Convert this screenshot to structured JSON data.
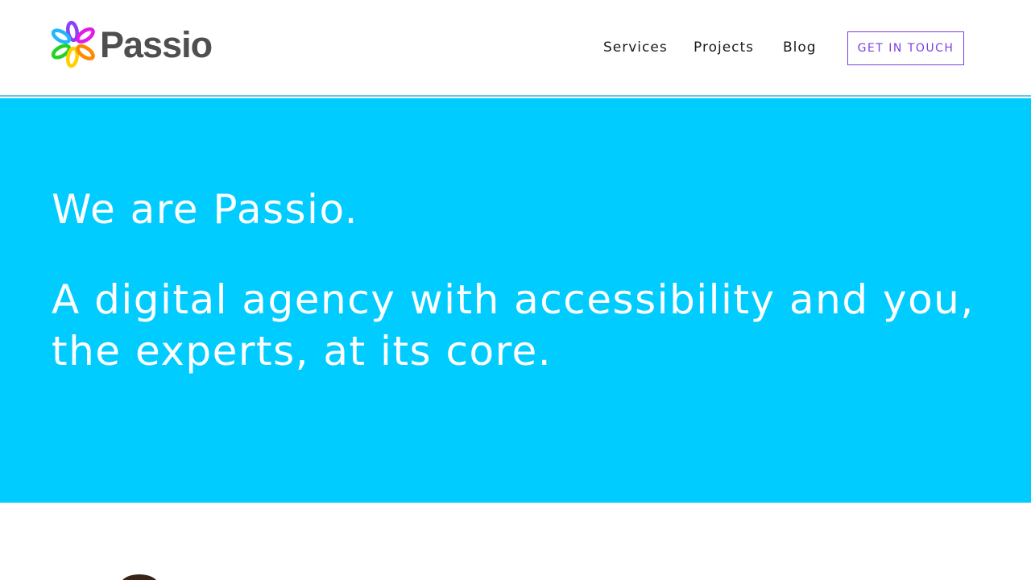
{
  "brand": {
    "name": "Passio",
    "colors": {
      "cyan": "#00ccff",
      "purple": "#7b3fe4",
      "text": "#4f4f4f"
    }
  },
  "nav": {
    "items": [
      {
        "label": "Services"
      },
      {
        "label": "Projects"
      },
      {
        "label": "Blog"
      }
    ],
    "cta_label": "GET IN TOUCH"
  },
  "hero": {
    "title": "We are Passio.",
    "subtitle": "A digital agency with accessibility and you, the experts, at its core."
  },
  "icons": {
    "logo": "passio-flower-logo-icon"
  }
}
